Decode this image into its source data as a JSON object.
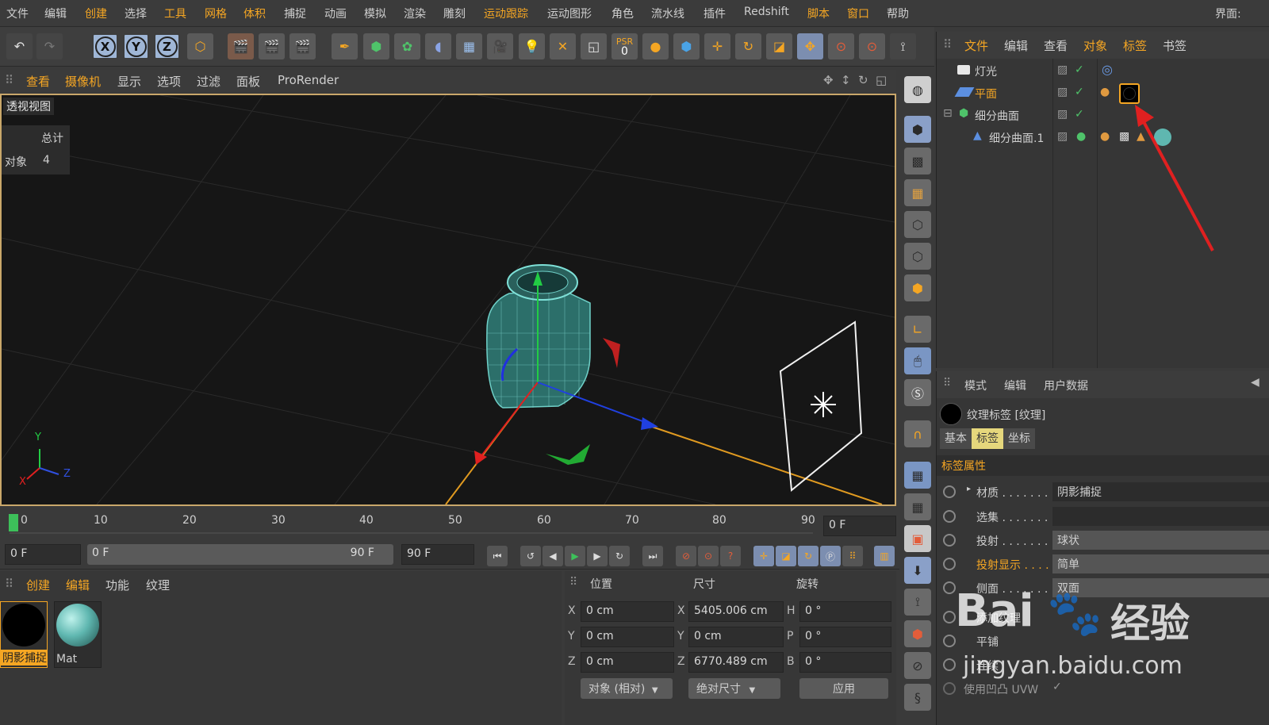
{
  "menu": {
    "items": [
      "文件",
      "编辑",
      "创建",
      "选择",
      "工具",
      "网格",
      "体积",
      "捕捉",
      "动画",
      "模拟",
      "渲染",
      "雕刻",
      "运动跟踪",
      "运动图形",
      "角色",
      "流水线",
      "插件",
      "Redshift",
      "脚本",
      "窗口",
      "帮助"
    ],
    "layout_label": "界面:"
  },
  "toolbar": {
    "psr_label": "PSR",
    "psr_value": "0"
  },
  "viewport_menu": {
    "items": [
      "查看",
      "摄像机",
      "显示",
      "选项",
      "过滤",
      "面板",
      "ProRender"
    ]
  },
  "viewport": {
    "title": "透视视图",
    "stats_header": "总计",
    "stats_label": "对象",
    "stats_value": "4",
    "axis_labels": {
      "y": "Y",
      "x": "X",
      "z": "Z"
    }
  },
  "object_manager": {
    "menu": [
      "文件",
      "编辑",
      "查看",
      "对象",
      "标签",
      "书签"
    ],
    "objects": [
      {
        "name": "灯光"
      },
      {
        "name": "平面"
      },
      {
        "name": "细分曲面"
      },
      {
        "name": "细分曲面.1"
      }
    ]
  },
  "attribute_manager": {
    "menu": [
      "模式",
      "编辑",
      "用户数据"
    ],
    "title": "纹理标签 [纹理]",
    "tabs": [
      "基本",
      "标签",
      "坐标"
    ],
    "section": "标签属性",
    "props": [
      {
        "label": "材质 . . . . . . .",
        "value": "阴影捕捉"
      },
      {
        "label": "选集 . . . . . . . .",
        "value": ""
      },
      {
        "label": "投射 . . . . . . . .",
        "value": "球状"
      },
      {
        "label": "投射显示 . . . .",
        "value": "简单"
      },
      {
        "label": "侧面 . . . . . . . .",
        "value": "双面"
      },
      {
        "label": "添加纹理",
        "value": ""
      },
      {
        "label": "平铺",
        "value": ""
      },
      {
        "label": "连续",
        "value": ""
      },
      {
        "label": "使用凹凸 UVW",
        "value": "✓"
      }
    ]
  },
  "timeline": {
    "ticks": [
      "0",
      "10",
      "20",
      "30",
      "40",
      "50",
      "60",
      "70",
      "80",
      "90"
    ],
    "current_frame": "0 F"
  },
  "transport": {
    "start": "0 F",
    "range_start": "0 F",
    "range_end": "90 F",
    "end": "90 F"
  },
  "material_manager": {
    "menu": [
      "创建",
      "编辑",
      "功能",
      "纹理"
    ],
    "materials": [
      {
        "name": "阴影捕捉",
        "color": "#000000"
      },
      {
        "name": "Mat",
        "color": "#5fb7b0"
      }
    ]
  },
  "coordinates": {
    "headers": [
      "位置",
      "尺寸",
      "旋转"
    ],
    "rows": [
      {
        "pos_label": "X",
        "pos": "0 cm",
        "size_label": "X",
        "size": "5405.006 cm",
        "rot_label": "H",
        "rot": "0 °"
      },
      {
        "pos_label": "Y",
        "pos": "0 cm",
        "size_label": "Y",
        "size": "0 cm",
        "rot_label": "P",
        "rot": "0 °"
      },
      {
        "pos_label": "Z",
        "pos": "0 cm",
        "size_label": "Z",
        "size": "6770.489 cm",
        "rot_label": "B",
        "rot": "0 °"
      }
    ],
    "mode": "对象 (相对)",
    "size_mode": "绝对尺寸",
    "apply": "应用"
  },
  "watermark": {
    "brand": "Bai",
    "suffix": "经验",
    "url": "jingyan.baidu.com"
  },
  "colors": {
    "accent": "#f5a623",
    "highlight_tab": "#e5d77c",
    "viewport_border": "#c9a76a",
    "mesh": "#5fb7b0",
    "arrow": "#e02020"
  }
}
